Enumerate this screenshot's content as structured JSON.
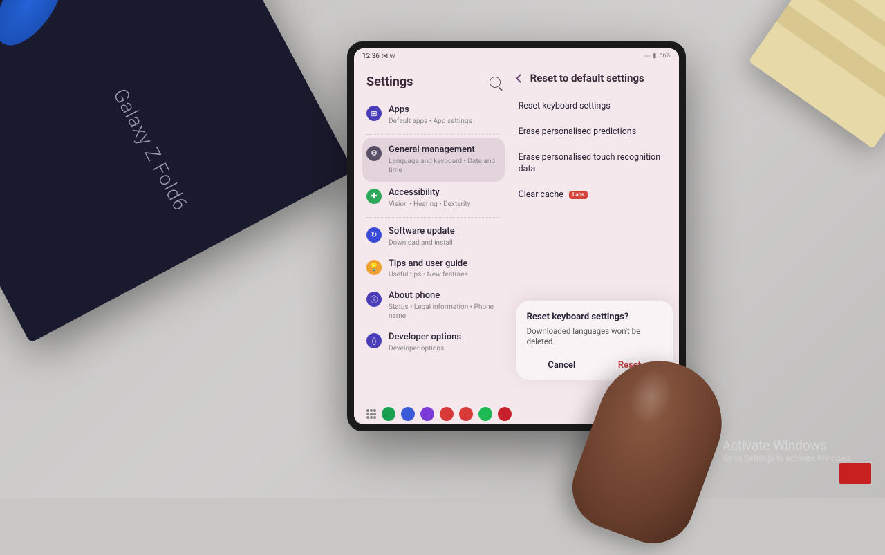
{
  "env": {
    "box_product": "Galaxy Z Fold6",
    "watermark_title": "Activate Windows",
    "watermark_sub": "Go to Settings to activate Windows."
  },
  "statusbar": {
    "time": "12:36",
    "indicators": "⋈ ᴡ",
    "battery": "66%"
  },
  "settings": {
    "title": "Settings",
    "items": [
      {
        "title": "Apps",
        "sub": "Default apps  •  App settings",
        "icon": "apps"
      },
      {
        "title": "General management",
        "sub": "Language and keyboard  •  Date and time",
        "icon": "general",
        "selected": true
      },
      {
        "title": "Accessibility",
        "sub": "Vision  •  Hearing  •  Dexterity",
        "icon": "accessibility"
      },
      {
        "title": "Software update",
        "sub": "Download and install",
        "icon": "software"
      },
      {
        "title": "Tips and user guide",
        "sub": "Useful tips  •  New features",
        "icon": "tips"
      },
      {
        "title": "About phone",
        "sub": "Status  •  Legal information  •  Phone name",
        "icon": "about"
      },
      {
        "title": "Developer options",
        "sub": "Developer options",
        "icon": "developer"
      }
    ]
  },
  "detail": {
    "title": "Reset to default settings",
    "options": [
      {
        "label": "Reset keyboard settings"
      },
      {
        "label": "Erase personalised predictions"
      },
      {
        "label": "Erase personalised touch recognition data"
      },
      {
        "label": "Clear cache",
        "badge": "Labs"
      }
    ]
  },
  "dialog": {
    "title": "Reset keyboard settings?",
    "body": "Downloaded languages won't be deleted.",
    "cancel": "Cancel",
    "confirm": "Reset"
  },
  "dock": {
    "apps": [
      {
        "name": "phone",
        "color": "#1aa050"
      },
      {
        "name": "messages",
        "color": "#3a5ad8"
      },
      {
        "name": "samsung-internet",
        "color": "#7a3ad8"
      },
      {
        "name": "app-red-snow",
        "color": "#d83a3a"
      },
      {
        "name": "youtube",
        "color": "#d83a3a"
      },
      {
        "name": "spotify",
        "color": "#1db954"
      },
      {
        "name": "acrobat",
        "color": "#c8202a"
      }
    ]
  }
}
